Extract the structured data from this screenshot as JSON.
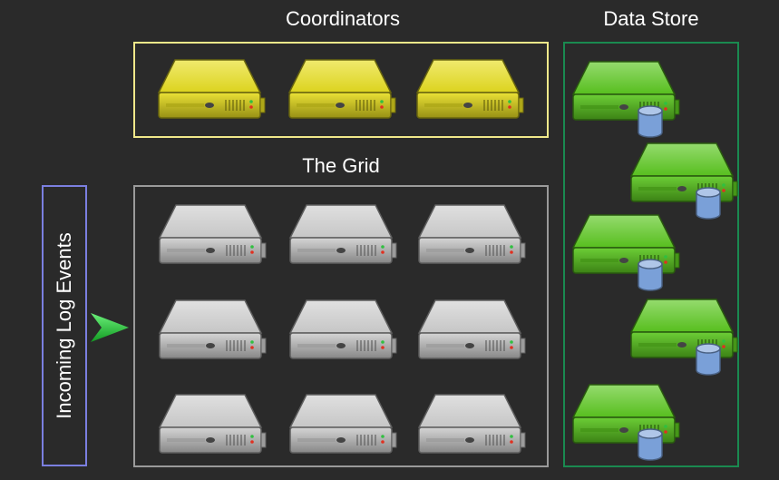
{
  "titles": {
    "coordinators": "Coordinators",
    "data_store": "Data Store",
    "grid": "The Grid"
  },
  "incoming_label": "Incoming Log Events",
  "colors": {
    "background": "#2a2a2a",
    "coordinators_border": "#f0e88a",
    "grid_border": "#9a9a9a",
    "datastore_border": "#1a8a50",
    "incoming_border": "#7b7fe0",
    "arrow": "#22cc33",
    "server_yellow": "#e8de20",
    "server_gray": "#d0d0d0",
    "server_green": "#5cc820",
    "cylinder": "#7aa0d8"
  },
  "icons": {
    "coordinator": "yellow-server-icon",
    "grid_node": "gray-server-icon",
    "store_node": "green-server-icon",
    "store_db": "database-cylinder-icon",
    "flow": "green-arrow-icon"
  }
}
